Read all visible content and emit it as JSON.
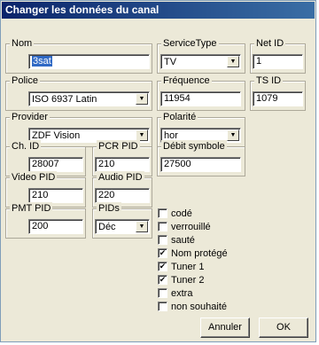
{
  "title": "Changer les données du canal",
  "nom": {
    "label": "Nom",
    "value": "3sat"
  },
  "service_type": {
    "label": "ServiceType",
    "value": "TV",
    "arrow": "▼"
  },
  "net_id": {
    "label": "Net ID",
    "value": "1"
  },
  "police": {
    "label": "Police",
    "value": "ISO 6937 Latin",
    "arrow": "▼"
  },
  "frequence": {
    "label": "Fréquence",
    "value": "11954"
  },
  "ts_id": {
    "label": "TS ID",
    "value": "1079"
  },
  "provider": {
    "label": "Provider",
    "value": "ZDF Vision",
    "arrow": "▼"
  },
  "polarite": {
    "label": "Polarité",
    "value": "hor",
    "arrow": "▼"
  },
  "ch_id": {
    "label": "Ch. ID",
    "value": "28007"
  },
  "pcr_pid": {
    "label": "PCR PID",
    "value": "210"
  },
  "debit_symbole": {
    "label": "Débit symbole",
    "value": "27500"
  },
  "video_pid": {
    "label": "Video PID",
    "value": "210"
  },
  "audio_pid": {
    "label": "Audio PID",
    "value": "220"
  },
  "pmt_pid": {
    "label": "PMT PID",
    "value": "200"
  },
  "pids": {
    "label": "PIDs",
    "value": "Déc",
    "arrow": "▼"
  },
  "checks": [
    {
      "label": "codé",
      "checked": false,
      "mark": ""
    },
    {
      "label": "verrouillé",
      "checked": false,
      "mark": ""
    },
    {
      "label": "sauté",
      "checked": false,
      "mark": ""
    },
    {
      "label": "Nom protégé",
      "checked": true,
      "mark": "✔"
    },
    {
      "label": "Tuner 1",
      "checked": true,
      "mark": "✔"
    },
    {
      "label": "Tuner 2",
      "checked": true,
      "mark": "✔"
    },
    {
      "label": "extra",
      "checked": false,
      "mark": ""
    },
    {
      "label": "non souhaité",
      "checked": false,
      "mark": ""
    }
  ],
  "buttons": {
    "cancel": "Annuler",
    "ok": "OK"
  }
}
